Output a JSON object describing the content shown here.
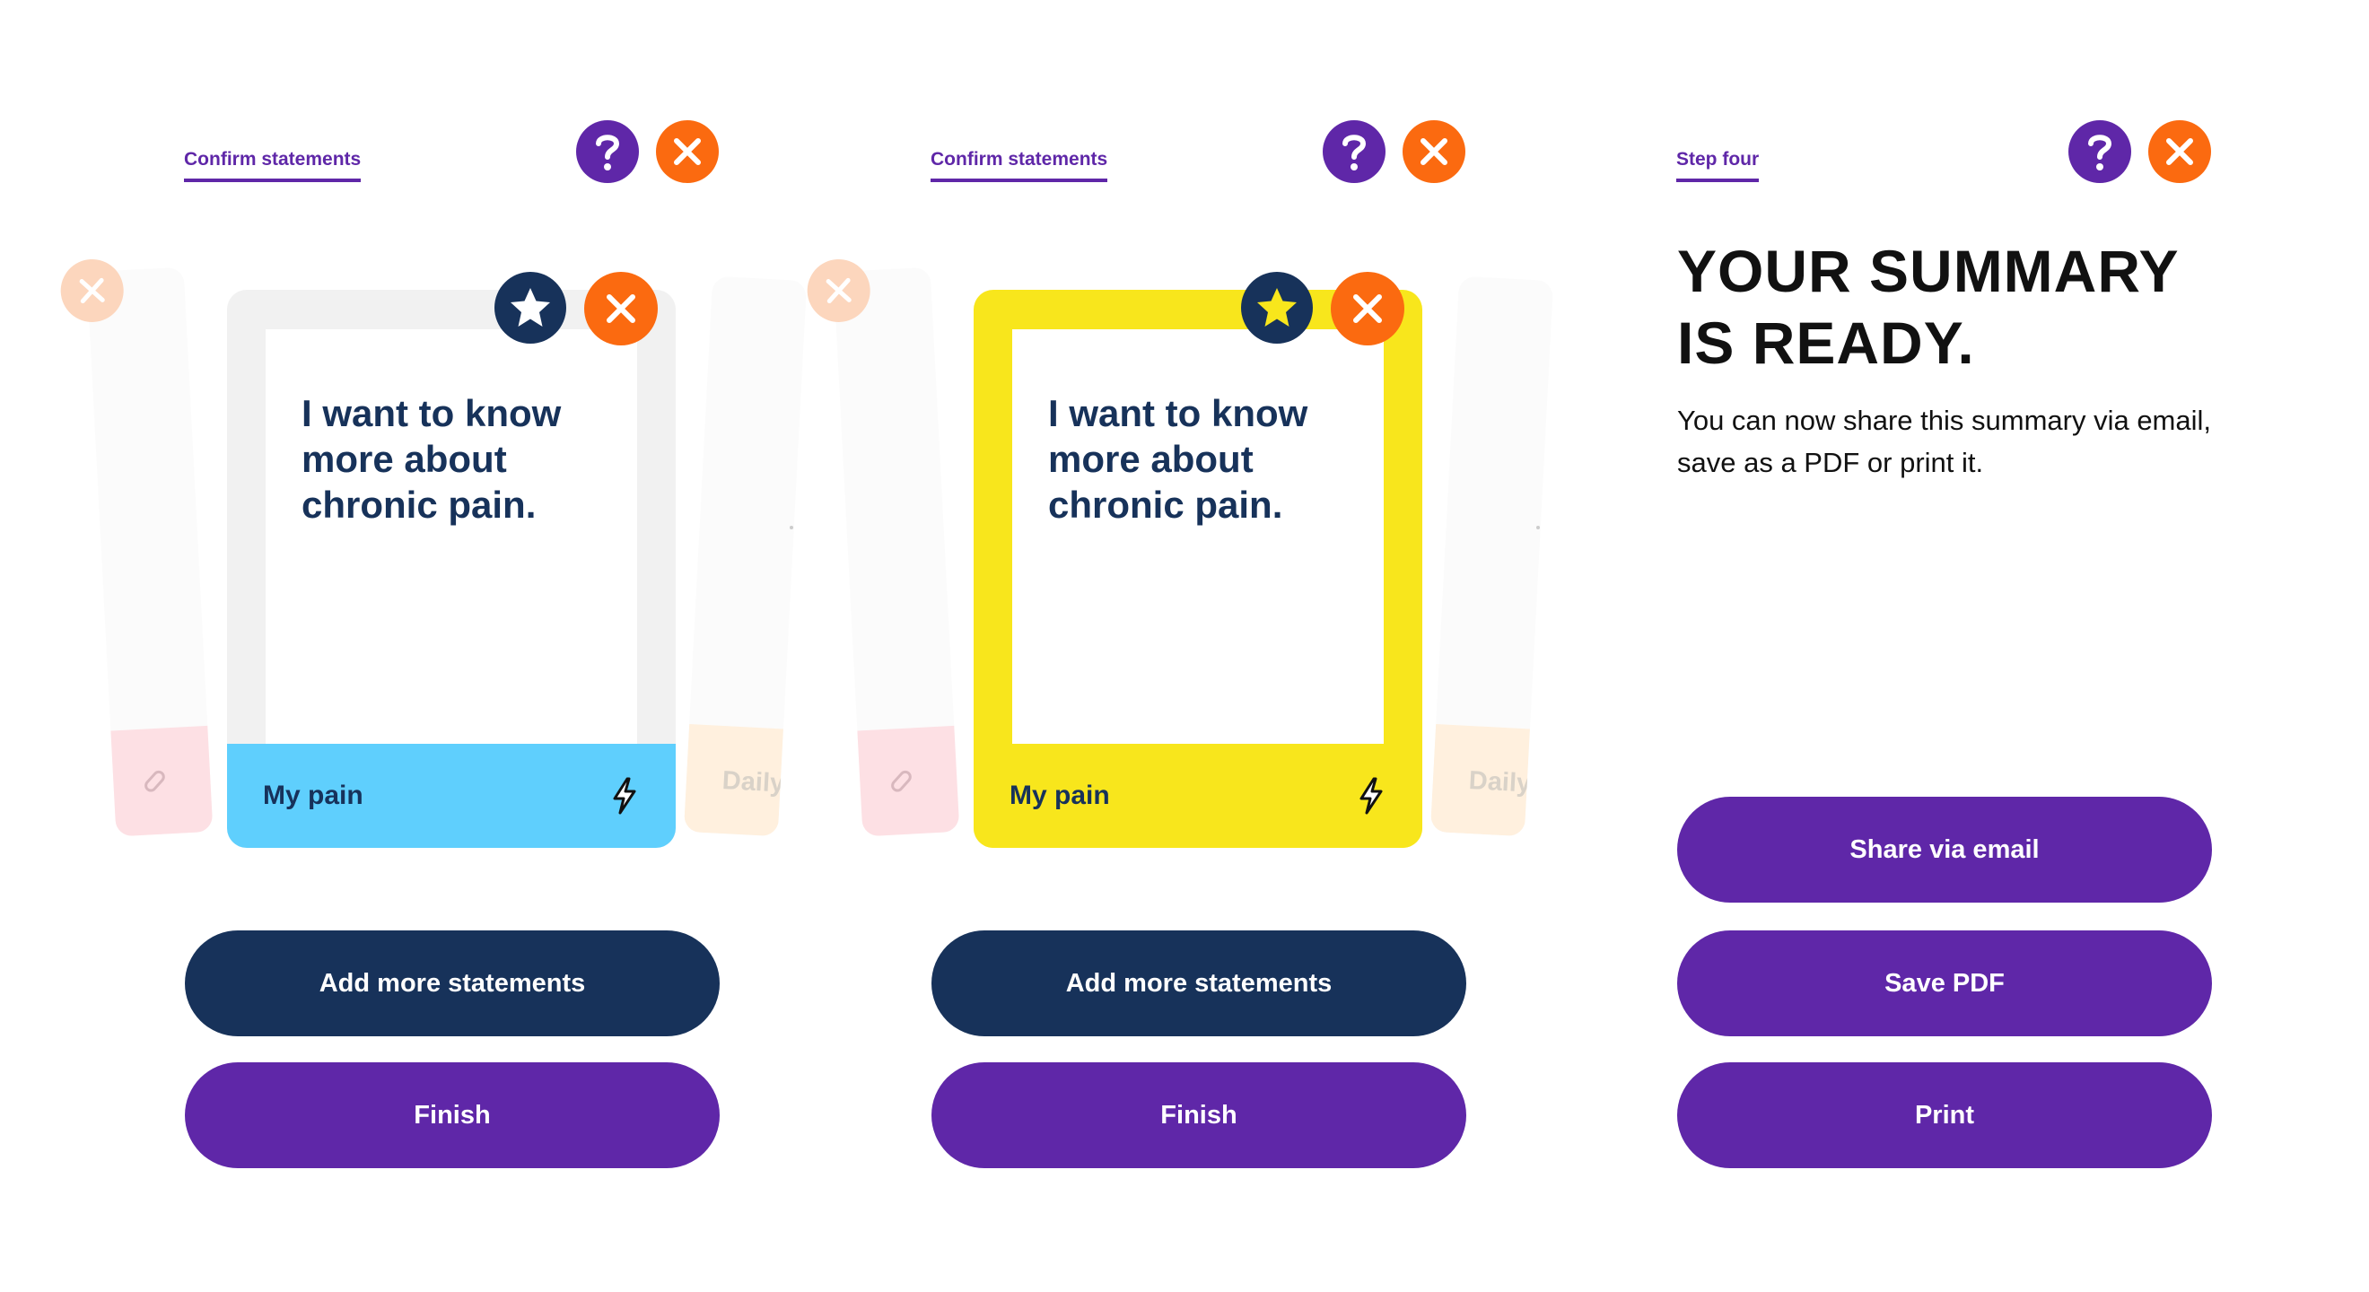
{
  "colors": {
    "purple": "#5f27a8",
    "orange": "#fb6a10",
    "navy": "#17325a",
    "yellow": "#f8e61c",
    "blue": "#5fcffd",
    "grey": "#f1f1f1"
  },
  "icons": {
    "help": "question-icon",
    "close": "close-icon",
    "star": "star-icon",
    "lightning": "lightning-icon",
    "pill": "pill-icon"
  },
  "screens": [
    {
      "step_label": "Confirm statements",
      "card": {
        "text": "I want to know more about chronic pain.",
        "category": "My pain",
        "starred": false
      },
      "ghost_label": "Daily",
      "buttons": [
        "Add more statements",
        "Finish"
      ]
    },
    {
      "step_label": "Confirm statements",
      "card": {
        "text": "I want to know more about chronic pain.",
        "category": "My pain",
        "starred": true
      },
      "ghost_label": "Daily",
      "buttons": [
        "Add more statements",
        "Finish"
      ]
    },
    {
      "step_label": "Step four",
      "title": "YOUR SUMMARY IS READY.",
      "body": "You can now share this summary via email, save as a PDF or print it.",
      "buttons": [
        "Share via email",
        "Save PDF",
        "Print"
      ]
    }
  ]
}
